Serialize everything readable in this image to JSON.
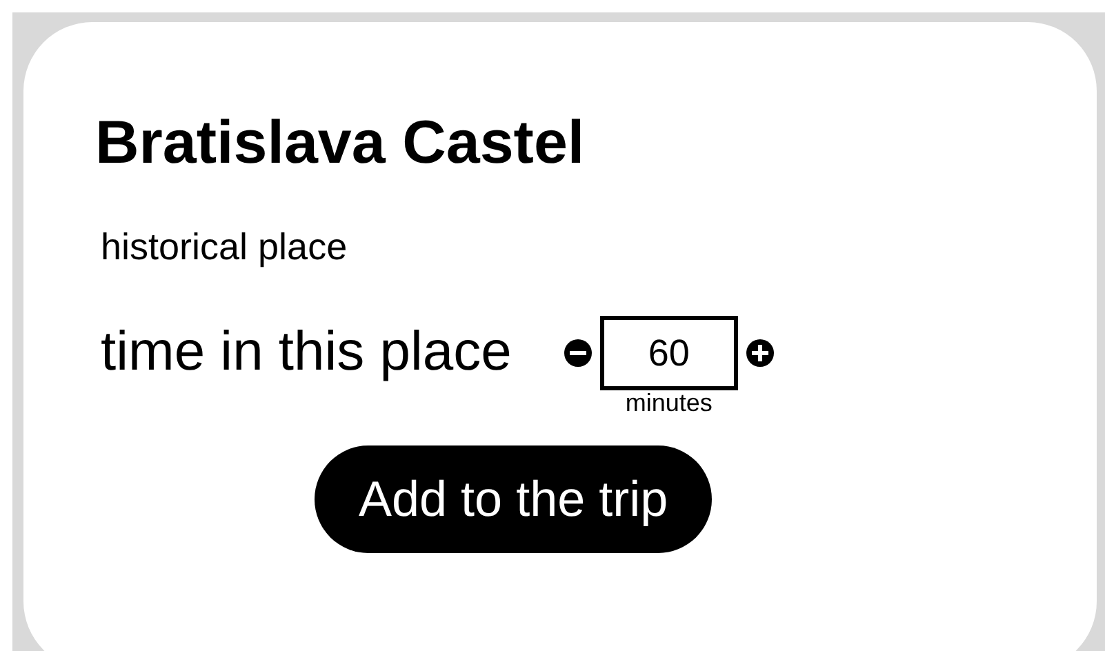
{
  "place": {
    "title": "Bratislava Castel",
    "category": "historical place"
  },
  "duration": {
    "label": "time in this place",
    "value": "60",
    "unit": "minutes"
  },
  "action": {
    "label": "Add to the trip"
  }
}
